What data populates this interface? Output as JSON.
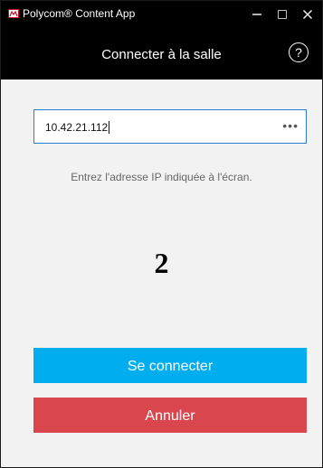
{
  "window": {
    "title": "Polycom® Content App",
    "minimize_glyph": "—",
    "maximize_glyph": "☐",
    "close_glyph": "✕"
  },
  "header": {
    "title": "Connecter à la salle",
    "help_glyph": "?"
  },
  "form": {
    "ip_value": "10.42.21.112",
    "more_glyph": "•••",
    "hint": "Entrez l'adresse IP indiquée à l'écran.",
    "pin": "2"
  },
  "buttons": {
    "connect_label": "Se connecter",
    "cancel_label": "Annuler"
  },
  "colors": {
    "titlebar": "#000000",
    "content_background": "#f2f2f2",
    "connect_button": "#00aeef",
    "cancel_button": "#d9464e",
    "input_focus_border": "#2b7bd8"
  },
  "icons": {
    "app": "polycom-app-icon",
    "help": "question-mark-circle-icon",
    "more": "more-dots-icon"
  }
}
